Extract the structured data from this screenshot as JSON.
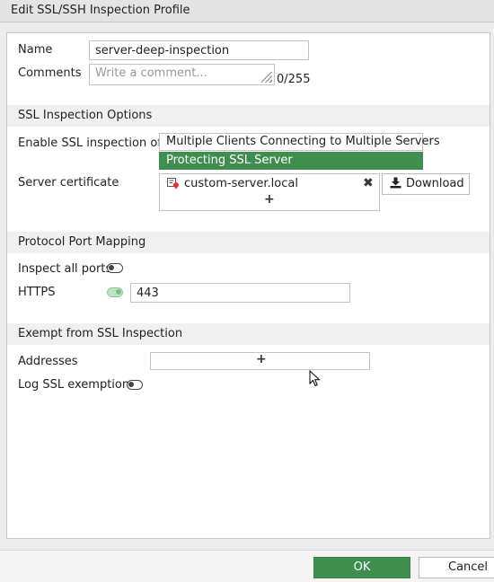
{
  "window": {
    "title": "Edit SSL/SSH Inspection Profile"
  },
  "general": {
    "name_label": "Name",
    "name_value": "server-deep-inspection",
    "comments_label": "Comments",
    "comments_placeholder": "Write a comment...",
    "comments_counter": "0/255"
  },
  "ssl_options": {
    "section_title": "SSL Inspection Options",
    "enable_label": "Enable SSL inspection of",
    "choices": [
      "Multiple Clients Connecting to Multiple Servers",
      "Protecting SSL Server"
    ],
    "selected_choice": "Protecting SSL Server",
    "server_cert_label": "Server certificate",
    "certificate": "custom-server.local",
    "download_label": "Download"
  },
  "port_mapping": {
    "section_title": "Protocol Port Mapping",
    "inspect_all_label": "Inspect all ports",
    "inspect_all_on": false,
    "https_label": "HTTPS",
    "https_on": true,
    "https_port": "443"
  },
  "exempt": {
    "section_title": "Exempt from SSL Inspection",
    "addresses_label": "Addresses",
    "log_label": "Log SSL exemptions",
    "log_on": false
  },
  "footer": {
    "ok_label": "OK",
    "cancel_label": "Cancel"
  },
  "colors": {
    "accent_green": "#3f8e4f",
    "toggle_on": "#7bbd8a"
  }
}
